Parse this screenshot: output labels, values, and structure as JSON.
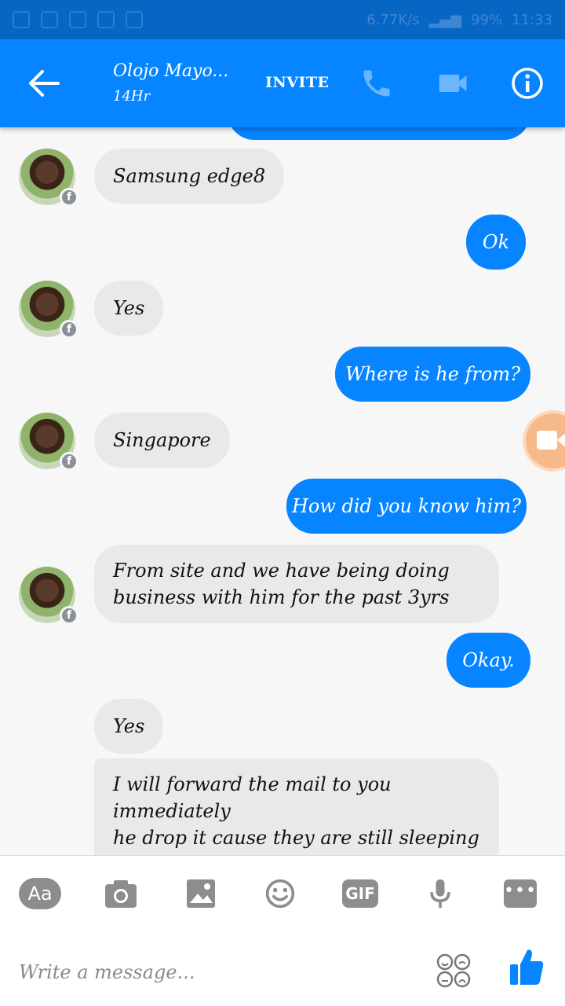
{
  "status_bar": {
    "speed": "6.77K/s",
    "battery": "99%",
    "time": "11:33"
  },
  "header": {
    "contact_name": "Olojo Mayo...",
    "contact_status": "14Hr",
    "invite_label": "INVITE"
  },
  "messages": [
    {
      "side": "in",
      "text": "Samsung edge8"
    },
    {
      "side": "out",
      "text": "Ok"
    },
    {
      "side": "in",
      "text": "Yes"
    },
    {
      "side": "out",
      "text": "Where is he from?"
    },
    {
      "side": "in",
      "text": "Singapore"
    },
    {
      "side": "out",
      "text": "How did you know him?"
    },
    {
      "side": "in",
      "text": "From site and we have being doing\nbusiness with him for the past 3yrs"
    },
    {
      "side": "out",
      "text": "Okay."
    },
    {
      "side": "in",
      "text": "Yes"
    },
    {
      "side": "in",
      "text": "I will forward the mail to you immediately\nhe drop it cause they are still sleeping in\nthere country"
    }
  ],
  "composer": {
    "aa_label": "Aa",
    "gif_label": "GIF",
    "more_label": "•••",
    "placeholder": "Write a message..."
  },
  "colors": {
    "accent": "#0784ff",
    "status_bar": "#0765c4",
    "incoming_bubble": "#e9e9e9"
  },
  "icons": [
    "back-arrow-icon",
    "phone-icon",
    "video-camera-icon",
    "info-icon",
    "camera-icon",
    "image-icon",
    "emoji-icon",
    "microphone-icon",
    "emoji-grid-icon",
    "thumbs-up-icon"
  ]
}
